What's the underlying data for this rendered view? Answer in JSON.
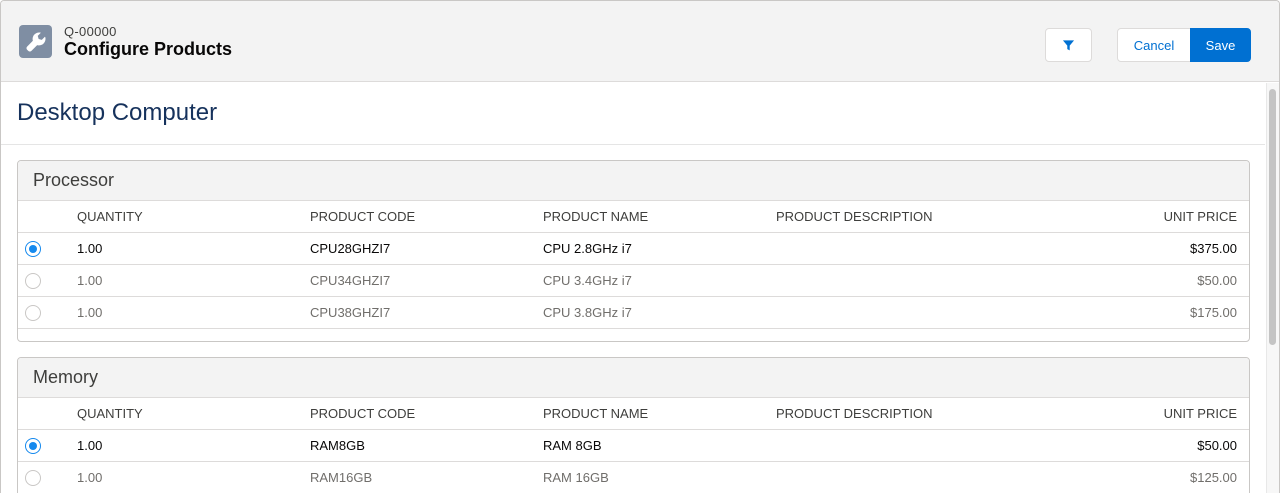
{
  "header": {
    "record_id": "Q-00000",
    "title": "Configure Products",
    "app_icon": "wrench-icon",
    "filter_icon": "filter-icon",
    "cancel_label": "Cancel",
    "save_label": "Save"
  },
  "product": {
    "title": "Desktop Computer"
  },
  "columns": {
    "quantity": "QUANTITY",
    "code": "PRODUCT CODE",
    "name": "PRODUCT NAME",
    "description": "PRODUCT DESCRIPTION",
    "price": "UNIT PRICE"
  },
  "groups": [
    {
      "name": "Processor",
      "rows": [
        {
          "selected": true,
          "quantity": "1.00",
          "code": "CPU28GHZI7",
          "name": "CPU 2.8GHz i7",
          "description": "",
          "price": "$375.00"
        },
        {
          "selected": false,
          "quantity": "1.00",
          "code": "CPU34GHZI7",
          "name": "CPU 3.4GHz i7",
          "description": "",
          "price": "$50.00"
        },
        {
          "selected": false,
          "quantity": "1.00",
          "code": "CPU38GHZI7",
          "name": "CPU 3.8GHz i7",
          "description": "",
          "price": "$175.00"
        }
      ]
    },
    {
      "name": "Memory",
      "rows": [
        {
          "selected": true,
          "quantity": "1.00",
          "code": "RAM8GB",
          "name": "RAM 8GB",
          "description": "",
          "price": "$50.00"
        },
        {
          "selected": false,
          "quantity": "1.00",
          "code": "RAM16GB",
          "name": "RAM 16GB",
          "description": "",
          "price": "$125.00"
        }
      ]
    }
  ],
  "colors": {
    "brand": "#0070d2",
    "radio_selected": "#1589ee",
    "title": "#16325c"
  }
}
